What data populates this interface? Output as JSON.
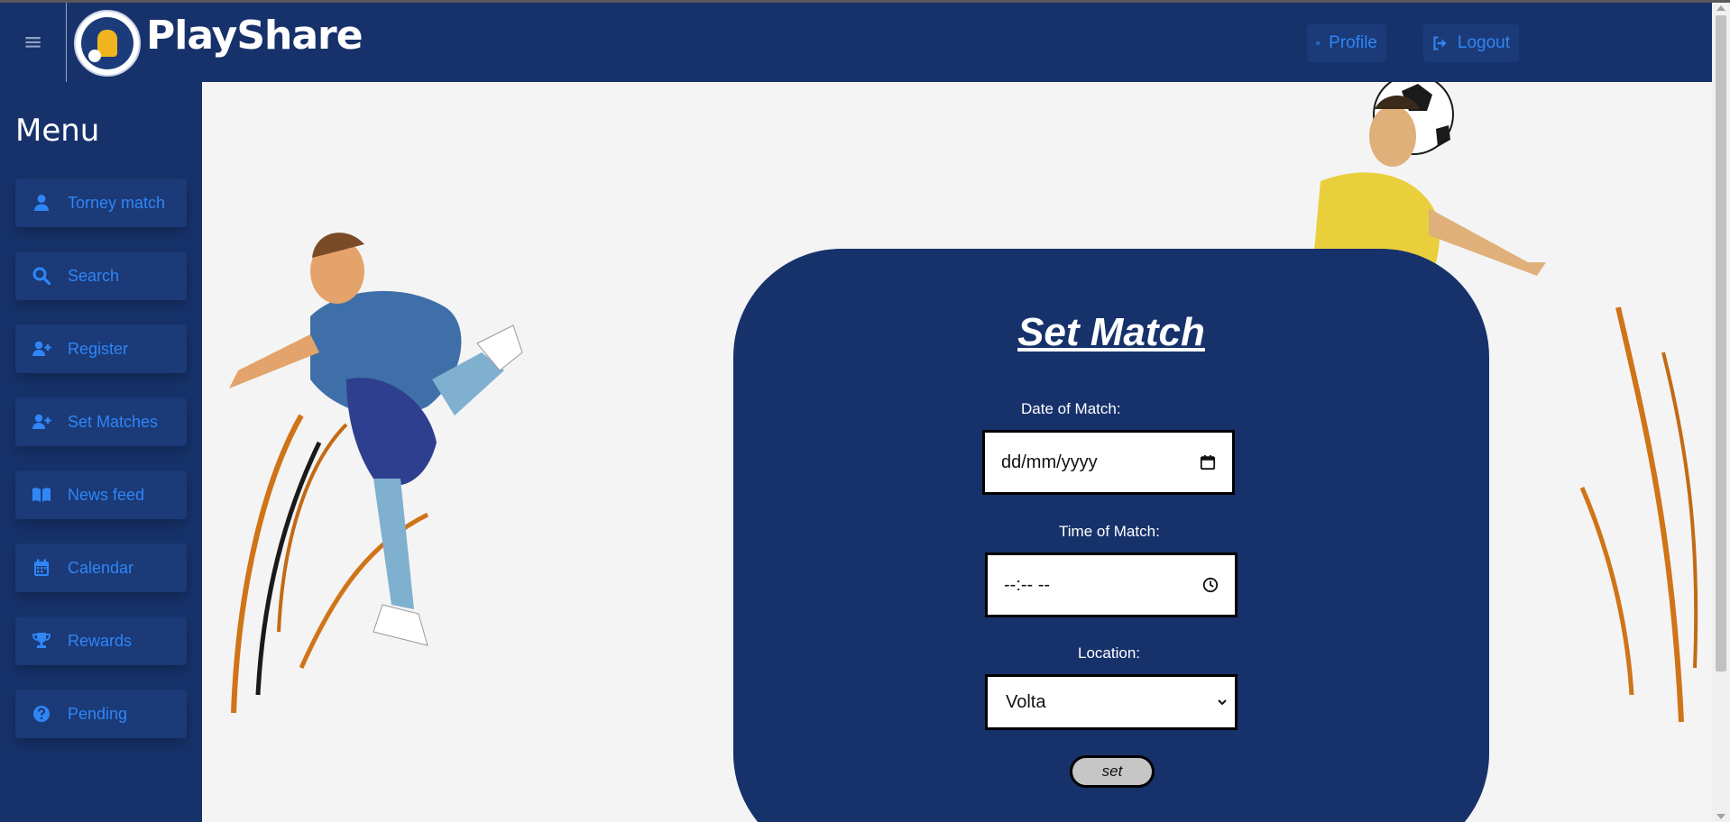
{
  "header": {
    "brand": "PlayShare",
    "menu_toggle_icon": "hamburger-icon",
    "profile_label": "Profile",
    "profile_icon": "user-circle-icon",
    "logout_label": "Logout",
    "logout_icon": "sign-out-icon"
  },
  "sidebar": {
    "title": "Menu",
    "items": [
      {
        "label": "Torney match",
        "icon": "user-icon"
      },
      {
        "label": "Search",
        "icon": "search-icon"
      },
      {
        "label": "Register",
        "icon": "user-plus-icon"
      },
      {
        "label": "Set Matches",
        "icon": "user-plus-icon"
      },
      {
        "label": "News feed",
        "icon": "book-open-icon"
      },
      {
        "label": "Calendar",
        "icon": "calendar-icon"
      },
      {
        "label": "Rewards",
        "icon": "trophy-icon"
      },
      {
        "label": "Pending",
        "icon": "question-circle-icon"
      }
    ]
  },
  "form": {
    "title": "Set Match",
    "date_label": "Date of Match:",
    "date_placeholder": "dd/mm/yyyy",
    "time_label": "Time of Match:",
    "time_placeholder": "--:-- --",
    "location_label": "Location:",
    "location_value": "Volta",
    "submit_label": "set"
  },
  "colors": {
    "navy": "#17326b",
    "accent_blue": "#2f86f6",
    "background": "#f4f4f4"
  }
}
